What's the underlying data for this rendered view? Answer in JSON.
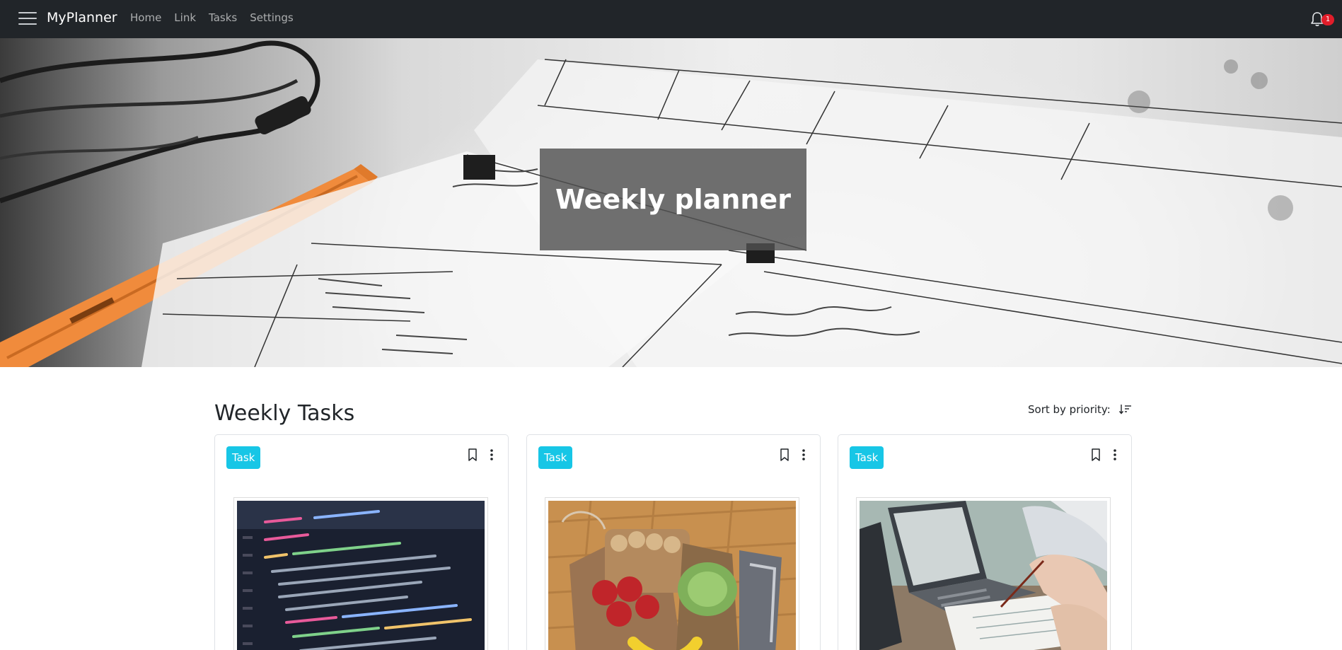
{
  "navbar": {
    "menu_icon": "hamburger-icon",
    "brand": "MyPlanner",
    "links": [
      "Home",
      "Link",
      "Tasks",
      "Settings"
    ],
    "notification_icon": "bell-icon",
    "notification_count": "1"
  },
  "hero": {
    "title": "Weekly planner"
  },
  "section": {
    "title": "Weekly Tasks",
    "sort_label": "Sort by priority:",
    "sort_icon": "sort-descending-icon"
  },
  "cards": [
    {
      "badge": "Task",
      "image": "code-screen-photo"
    },
    {
      "badge": "Task",
      "image": "grocery-bag-photo"
    },
    {
      "badge": "Task",
      "image": "laptop-desk-photo"
    }
  ],
  "colors": {
    "navbar_bg": "#212529",
    "badge_bg": "#17c6e6",
    "notification_badge": "#e11d2a"
  }
}
